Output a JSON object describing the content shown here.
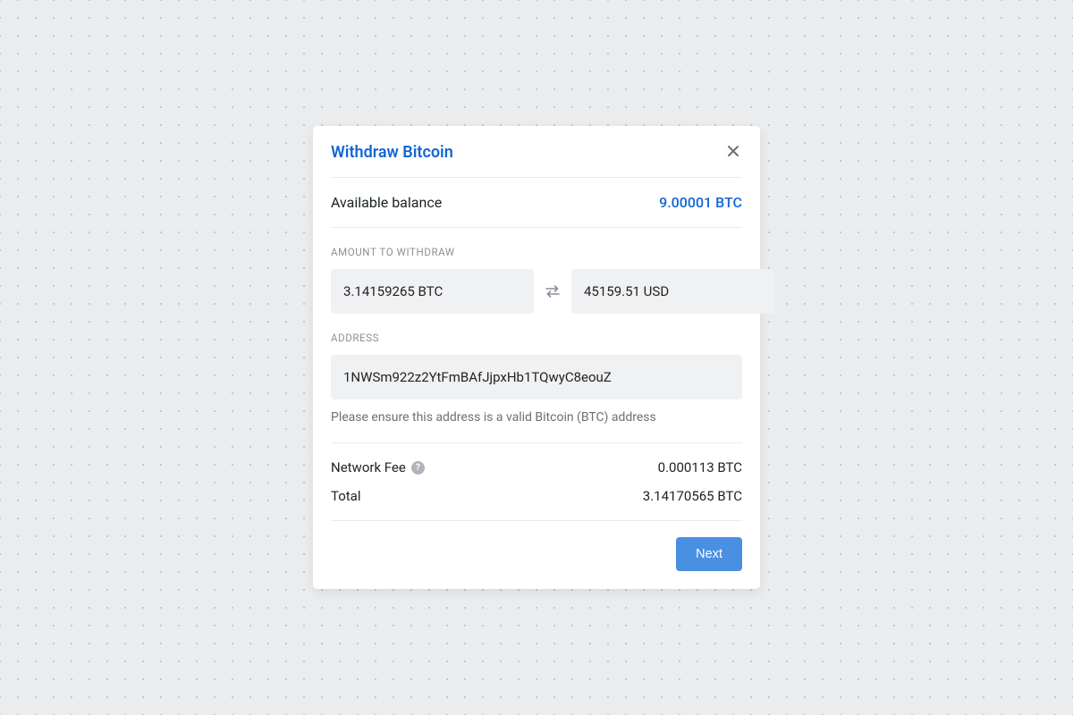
{
  "modal": {
    "title": "Withdraw Bitcoin",
    "balance": {
      "label": "Available balance",
      "value": "9.00001 BTC"
    },
    "amount": {
      "section_label": "AMOUNT TO WITHDRAW",
      "crypto_value": "3.14159265 BTC",
      "fiat_value": "45159.51 USD"
    },
    "address": {
      "section_label": "ADDRESS",
      "value": "1NWSm922z2YtFmBAfJjpxHb1TQwyC8eouZ",
      "helper": "Please ensure this address is a valid Bitcoin (BTC) address"
    },
    "fee": {
      "label": "Network Fee",
      "value": "0.000113 BTC"
    },
    "total": {
      "label": "Total",
      "value": "3.14170565 BTC"
    },
    "next_label": "Next"
  }
}
